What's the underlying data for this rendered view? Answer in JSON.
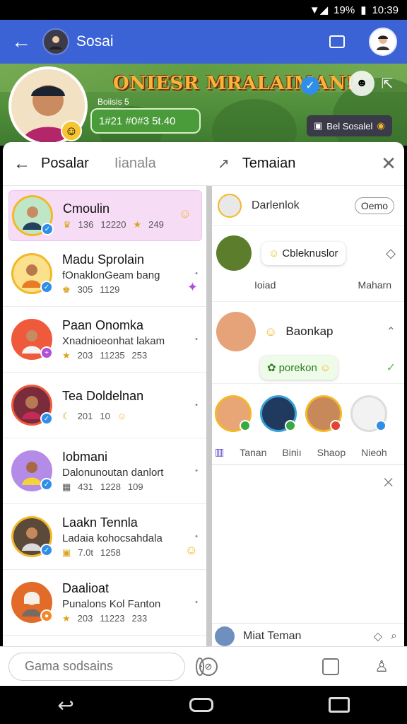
{
  "status": {
    "battery": "19%",
    "time": "10:39"
  },
  "app_bar": {
    "title": "Sosai"
  },
  "banner": {
    "title": "ONIESR MRALAIMAN!",
    "handle": "Boiisis 5",
    "stats": "1#21 #0#3 5t.40",
    "social_chip": "Bel Sosalel"
  },
  "left_panel": {
    "tabs": [
      "Posalar",
      "Iianala"
    ],
    "friends": [
      {
        "name": "Cmoulin",
        "sub": "",
        "meta": [
          "136",
          "12220",
          "249"
        ],
        "highlight": true
      },
      {
        "name": "Madu Sprolain",
        "sub": "fOnaklonGeam bang",
        "meta": [
          "305",
          "1129"
        ],
        "highlight": false
      },
      {
        "name": "Paan Onomka",
        "sub": "Xnadnioeonhat lakam",
        "meta": [
          "203",
          "11235",
          "253"
        ],
        "highlight": false
      },
      {
        "name": "Tea Doldelnan",
        "sub": "",
        "meta": [
          "201",
          "10"
        ],
        "highlight": false
      },
      {
        "name": "Iobmani",
        "sub": "Dalonunoutan danlort",
        "meta": [
          "431",
          "1228",
          "109"
        ],
        "highlight": false
      },
      {
        "name": "Laakn Tennla",
        "sub": "Ladaia kohocsahdala",
        "meta": [
          "7.0t",
          "1258"
        ],
        "highlight": false
      },
      {
        "name": "Daalioat",
        "sub": "Punalons Kol Fanton",
        "meta": [
          "203",
          "11223",
          "233"
        ],
        "highlight": false
      }
    ]
  },
  "right_panel": {
    "title": "Temaian",
    "row1": {
      "name": "Darlenlok",
      "button": "Oemo"
    },
    "card1": {
      "bubble": "Cbleknuslor",
      "left": "Ioiad",
      "right": "Maharn"
    },
    "card2": {
      "name": "Baonkap",
      "bubble": "porekon"
    },
    "nav_tabs": [
      "Tanan",
      "Biniı",
      "Shaop",
      "Nieoh"
    ],
    "bottom_link": "Miat Teman"
  },
  "bottom_bar": {
    "search_placeholder": "Gama sodsains"
  },
  "colors": {
    "app_bar": "#3b63d6",
    "highlight": "#f7dcf6",
    "accent_gold": "#f2b829",
    "verify_blue": "#2f8ee7"
  }
}
